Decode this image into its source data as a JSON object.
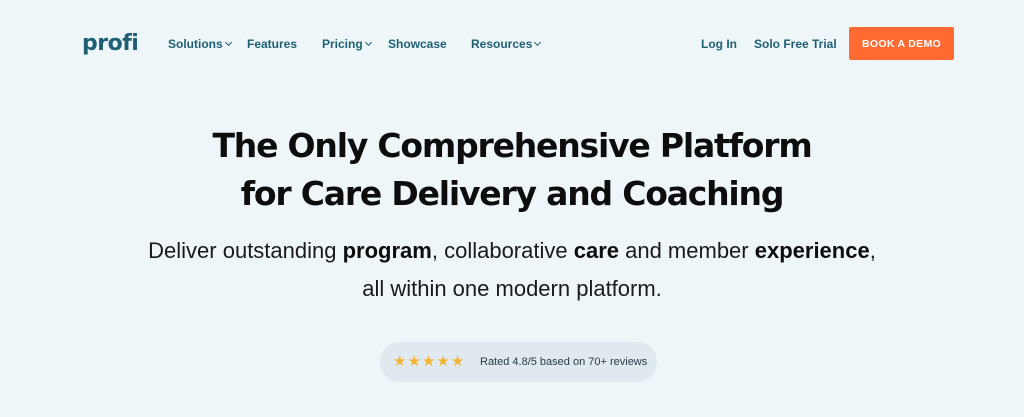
{
  "brand": {
    "logo_text": "profi",
    "accent": "#ff6a32",
    "primary": "#1f5f74"
  },
  "nav": {
    "items": [
      {
        "label": "Solutions",
        "has_dropdown": true
      },
      {
        "label": "Features",
        "has_dropdown": false
      },
      {
        "label": "Pricing",
        "has_dropdown": true
      },
      {
        "label": "Showcase",
        "has_dropdown": false
      },
      {
        "label": "Resources",
        "has_dropdown": true
      }
    ],
    "login_label": "Log In",
    "trial_label": "Solo Free Trial",
    "demo_label": "BOOK A DEMO"
  },
  "hero": {
    "title_line1": "The Only Comprehensive Platform",
    "title_line2": "for Care Delivery and Coaching",
    "sub_1": "Deliver outstanding ",
    "sub_bold_1": "program",
    "sub_2": ", collaborative ",
    "sub_bold_2": "care",
    "sub_3": " and member ",
    "sub_bold_3": "experience",
    "sub_4": ",",
    "sub_line2": "all within one modern platform."
  },
  "rating": {
    "stars": 5,
    "star_icon": "star-icon",
    "text": "Rated 4.8/5 based on 70+ reviews"
  }
}
